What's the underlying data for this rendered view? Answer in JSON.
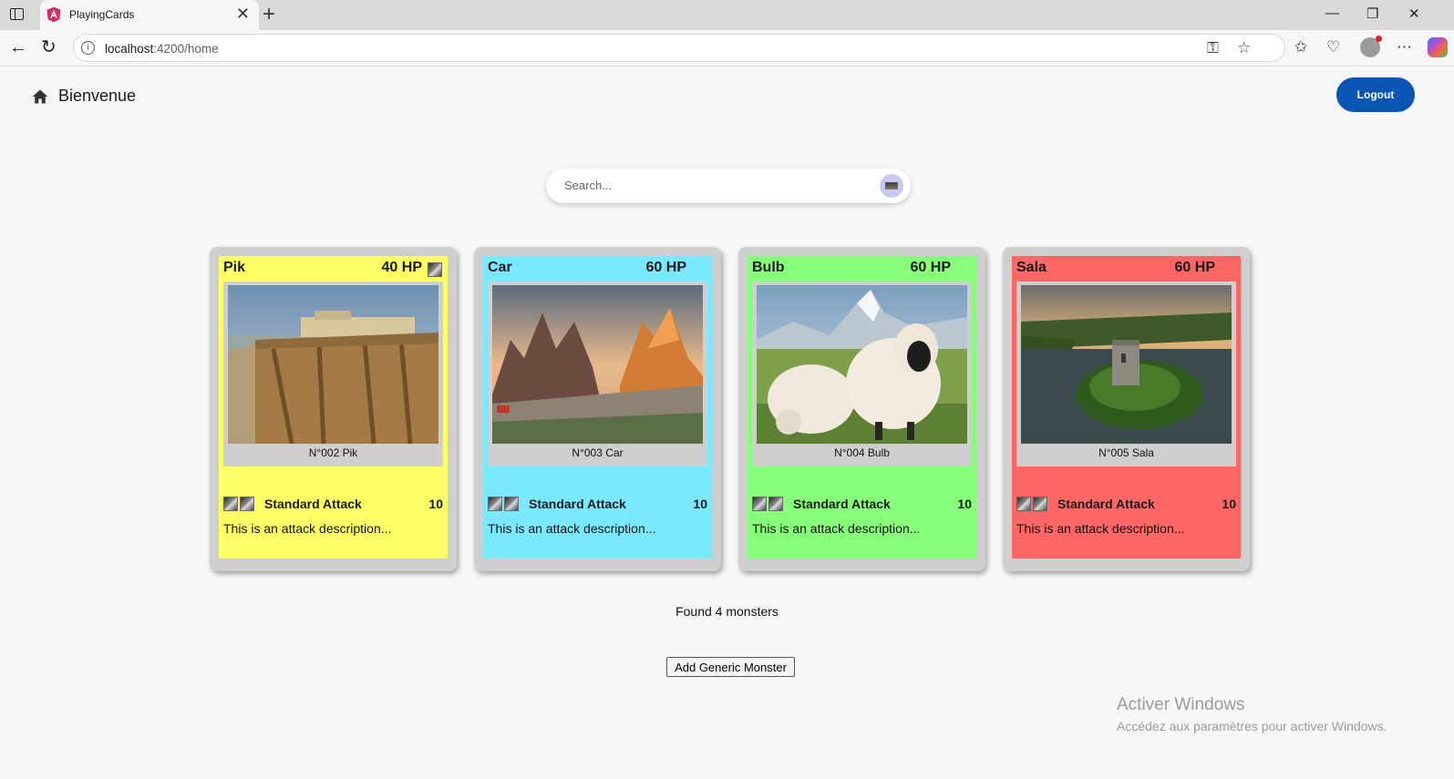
{
  "browser": {
    "tab_title": "PlayingCards",
    "url_host": "localhost",
    "url_rest": ":4200/home"
  },
  "header": {
    "welcome": "Bienvenue",
    "logout_label": "Logout"
  },
  "search": {
    "placeholder": "Search..."
  },
  "cards": [
    {
      "name": "Pik",
      "hp": "40 HP",
      "caption": "N°002 Pik",
      "attack_name": "Standard Attack",
      "attack_damage": "10",
      "attack_description": "This is an attack description...",
      "color": "#ffff66",
      "image": "cliff-town-icon"
    },
    {
      "name": "Car",
      "hp": "60 HP",
      "caption": "N°003 Car",
      "attack_name": "Standard Attack",
      "attack_damage": "10",
      "attack_description": "This is an attack description...",
      "color": "#7ae9ff",
      "image": "mountain-peaks-icon"
    },
    {
      "name": "Bulb",
      "hp": "60 HP",
      "caption": "N°004 Bulb",
      "attack_name": "Standard Attack",
      "attack_damage": "10",
      "attack_description": "This is an attack description...",
      "color": "#88ff7a",
      "image": "sheep-icon"
    },
    {
      "name": "Sala",
      "hp": "60 HP",
      "caption": "N°005 Sala",
      "attack_name": "Standard Attack",
      "attack_damage": "10",
      "attack_description": "This is an attack description...",
      "color": "#ff6666",
      "image": "island-castle-icon"
    }
  ],
  "footer": {
    "count_text": "Found 4 monsters",
    "add_label": "Add Generic Monster"
  },
  "watermark": {
    "line1": "Activer Windows",
    "line2": "Accédez aux paramètres pour activer Windows."
  }
}
